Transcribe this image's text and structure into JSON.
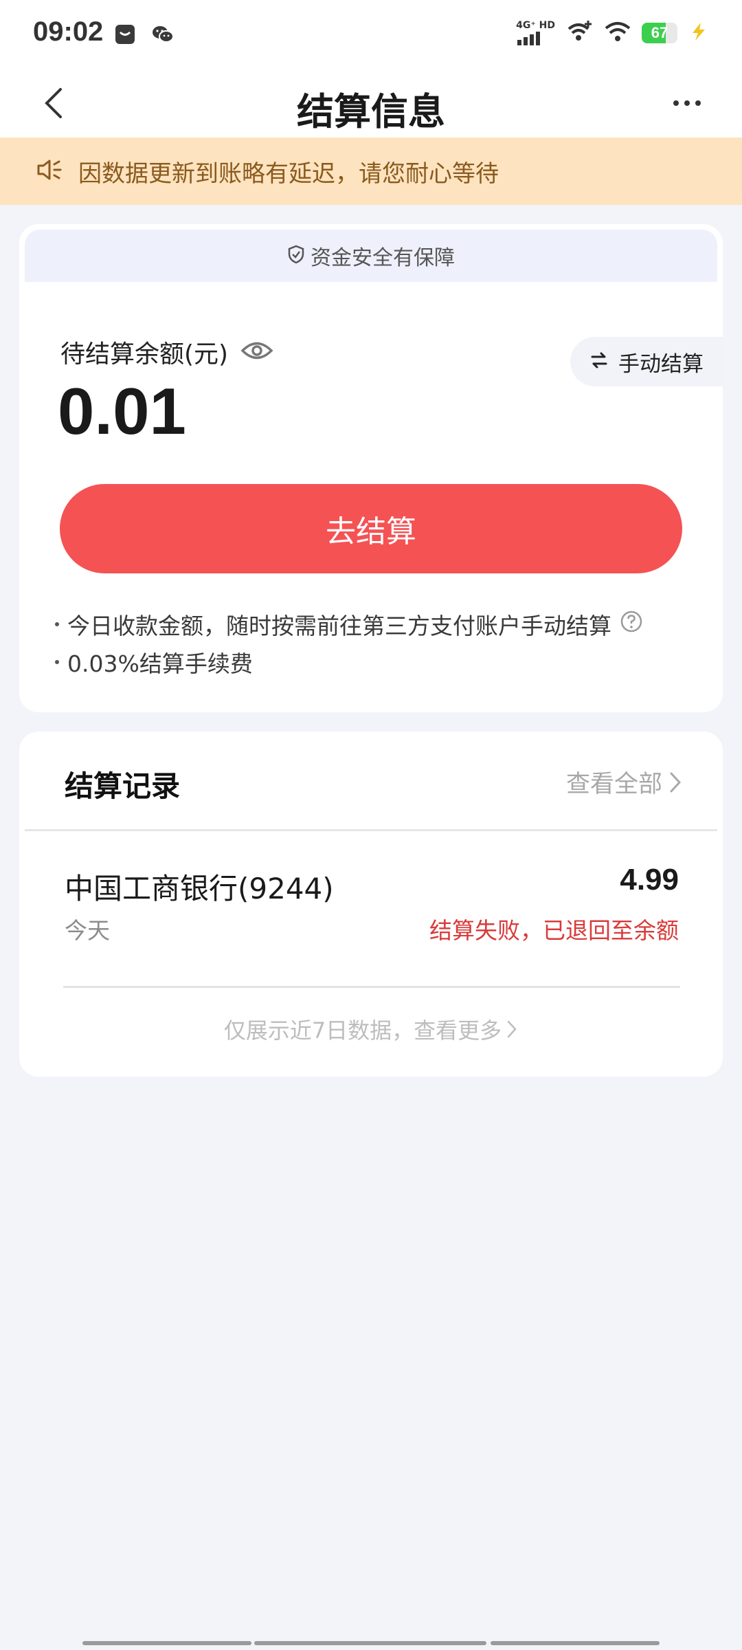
{
  "status_bar": {
    "time": "09:02",
    "network_label": "4G⁺ HD",
    "battery_level": 67,
    "battery_text": "67",
    "icons": [
      "message-icon",
      "wechat-icon",
      "signal-icon",
      "wifi-calling-icon",
      "wifi-icon",
      "battery-icon",
      "charging-icon"
    ]
  },
  "nav": {
    "title": "结算信息"
  },
  "notice": {
    "text": "因数据更新到账略有延迟，请您耐心等待"
  },
  "balance_card": {
    "safety_text": "资金安全有保障",
    "balance_label": "待结算余额(元)",
    "balance_amount": "0.01",
    "manual_button_label": "手动结算",
    "settle_button_label": "去结算",
    "tips": [
      "今日收款金额，随时按需前往第三方支付账户手动结算",
      "0.03%结算手续费"
    ]
  },
  "records": {
    "title": "结算记录",
    "view_all_label": "查看全部",
    "items": [
      {
        "bank": "中国工商银行(9244)",
        "date": "今天",
        "amount": "4.99",
        "status": "结算失败，已退回至余额"
      }
    ],
    "footer_text": "仅展示近7日数据，查看更多"
  },
  "colors": {
    "accent_red": "#f55254",
    "notice_bg": "#fde3bf",
    "notice_text": "#8a5a1e",
    "failure_red": "#d93a3a",
    "page_bg": "#f3f4f9"
  }
}
